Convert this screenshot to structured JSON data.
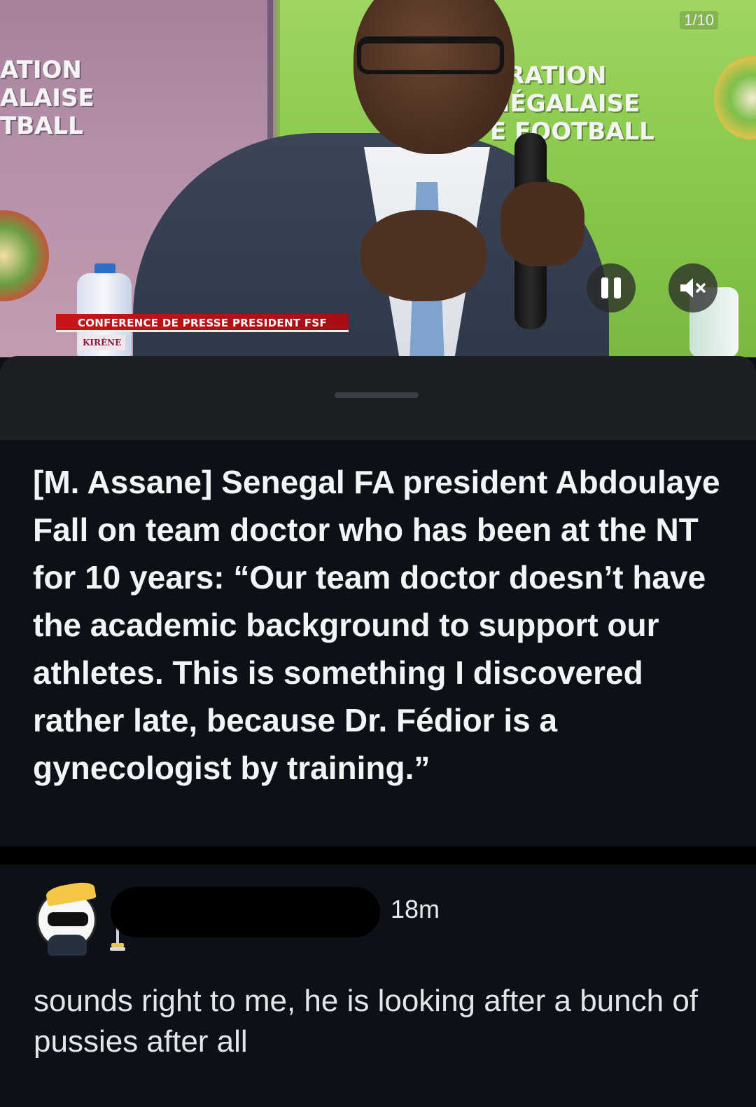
{
  "video": {
    "counter": "1/10",
    "banner_left": "ATION\nALAISE\nTBALL",
    "banner_right": "ÉRATION\nNÉGALAISE\nE FOOTBALL",
    "lower_third": "CONFERENCE DE PRESSE PRESIDENT FSF",
    "lower_tag": "KIRÈNE",
    "pause_icon": "pause-icon",
    "mute_icon": "volume-muted-icon"
  },
  "post": {
    "text": "[M. Assane] Senegal FA president Abdoulaye Fall on team doctor who has been at the NT for 10 years: “Our team doctor doesn’t have the academic background to support our athletes. This is something I discovered rather late, because Dr. Fédior is a gynecologist by training.”"
  },
  "comment": {
    "timestamp": "18m",
    "body": "sounds right to me, he is looking after a bunch of pussies after all"
  },
  "colors": {
    "background": "#0d1117",
    "sheet": "#1c1f24",
    "lower_third_red": "#c8141b",
    "text_primary": "#f3f4f6"
  }
}
